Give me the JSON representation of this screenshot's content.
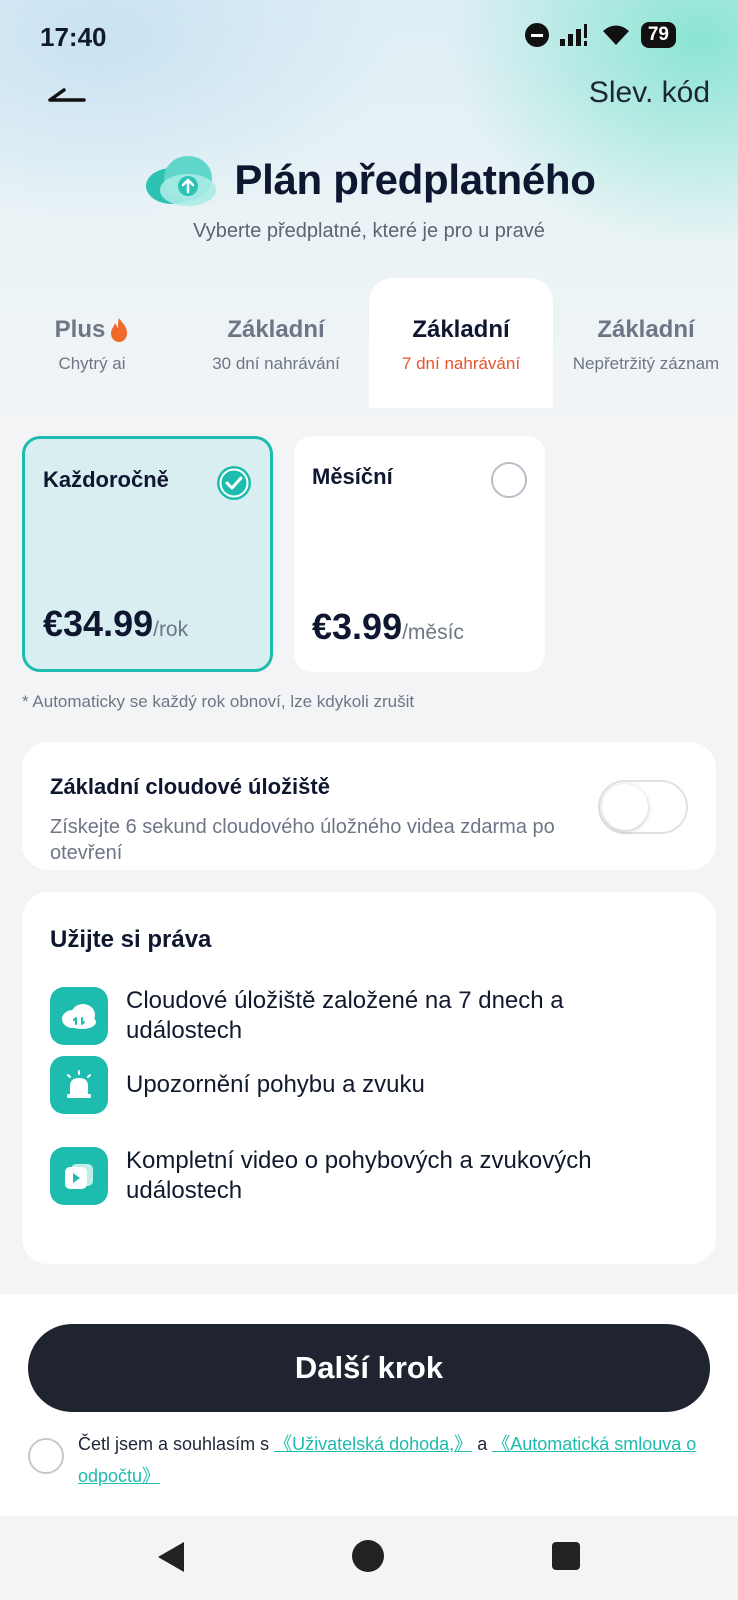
{
  "status_bar": {
    "time": "17:40",
    "battery": "79"
  },
  "header": {
    "discount_label": "Slev. kód"
  },
  "title": "Plán předplatného",
  "subtitle": "Vyberte předplatné, které je pro u pravé",
  "plan_tabs": [
    {
      "title": "Plus",
      "subtitle": "Chytrý ai"
    },
    {
      "title": "Základní",
      "subtitle": "30 dní nahrávání"
    },
    {
      "title": "Základní",
      "subtitle": "7 dní nahrávání"
    },
    {
      "title": "Základní",
      "subtitle": "Nepřetržitý záznam"
    }
  ],
  "periods": [
    {
      "name": "Každoročně",
      "price": "€34.99",
      "unit": "/rok"
    },
    {
      "name": "Měsíční",
      "price": "€3.99",
      "unit": "/měsíc"
    }
  ],
  "auto_renew_note": "* Automaticky se každý rok obnoví, lze kdykoli zrušit",
  "storage": {
    "title": "Základní cloudové úložiště",
    "description": "Získejte 6 sekund cloudového úložného videa zdarma po otevření"
  },
  "rights": {
    "title": "Užijte si práva",
    "items": [
      "Cloudové úložiště založené na 7 dnech a událostech",
      "Upozornění pohybu a zvuku",
      "Kompletní video o pohybových a zvukových událostech"
    ]
  },
  "next_button": "Další krok",
  "agreement": {
    "prefix": "Četl jsem a souhlasím s ",
    "link1": "《Uživatelská dohoda,》",
    "middle": " a ",
    "link2": "《Automatická smlouva o odpočtu》"
  },
  "colors": {
    "accent": "#1dbcae",
    "highlight": "#e8542b",
    "button": "#1f2430"
  }
}
